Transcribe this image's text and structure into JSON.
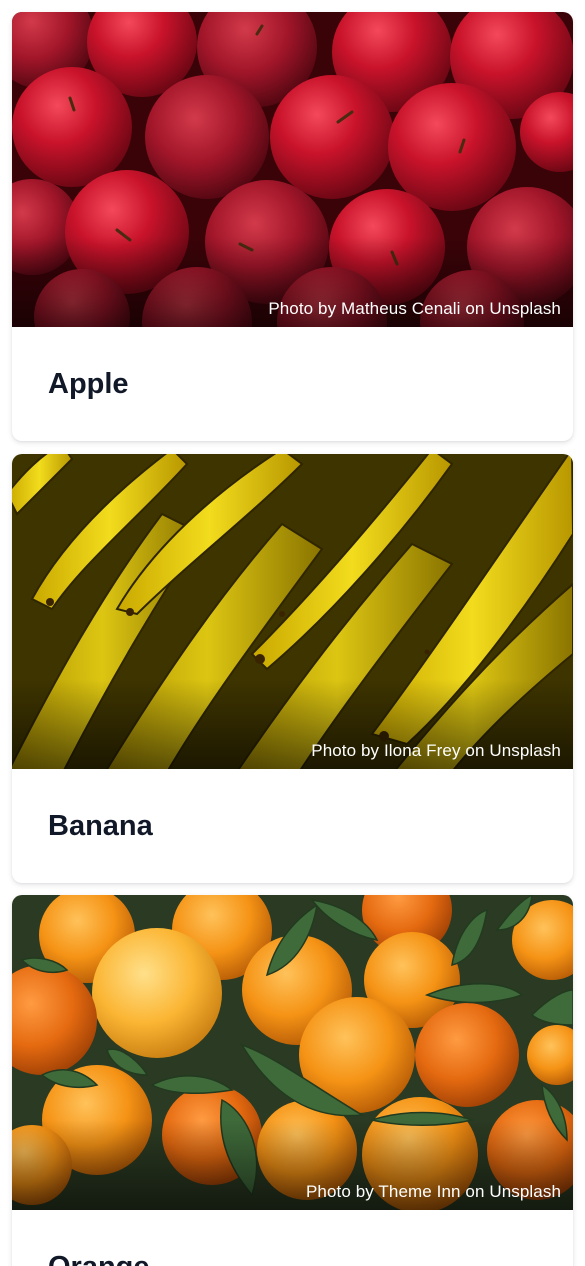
{
  "fruits": [
    {
      "name": "Apple",
      "credit": "Photo by Matheus Cenali on Unsplash",
      "photo_subject": "red apples"
    },
    {
      "name": "Banana",
      "credit": "Photo by Ilona Frey on Unsplash",
      "photo_subject": "yellow bananas"
    },
    {
      "name": "Orange",
      "credit": "Photo by Theme Inn on Unsplash",
      "photo_subject": "oranges with leaves"
    }
  ],
  "colors": {
    "title_text": "#111827",
    "card_background": "#ffffff",
    "credit_text": "#ffffff"
  }
}
